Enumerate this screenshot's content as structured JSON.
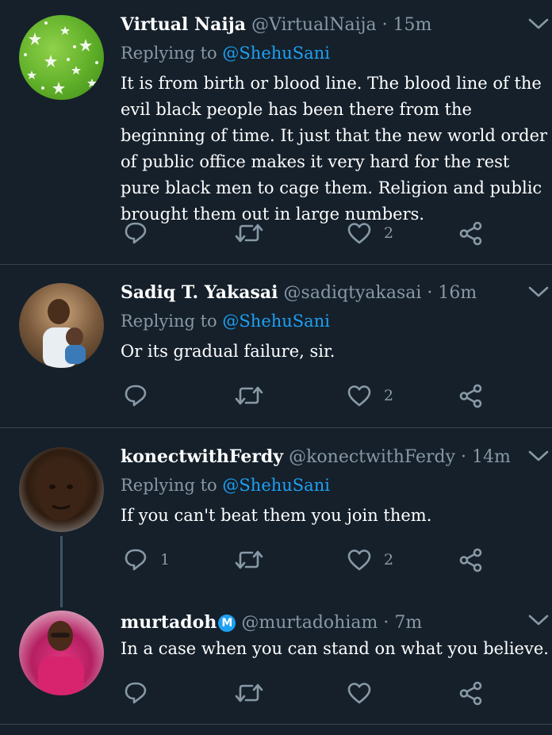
{
  "tweets": [
    {
      "name": "Virtual Naija",
      "handle": "@VirtualNaija",
      "time": "· 15m",
      "replying_prefix": "Replying to",
      "replying_to": "@ShehuSani",
      "text": "It is from birth or blood line. The blood line of the evil black people has been there from the beginning of time. It just that the new world order of public office makes it very hard for the rest pure black men to cage them. Religion and public brought them out in large numbers.",
      "replies": "",
      "retweets": "",
      "likes": "2"
    },
    {
      "name": "Sadiq T. Yakasai",
      "handle": "@sadiqtyakasai",
      "time": "· 16m",
      "replying_prefix": "Replying to",
      "replying_to": "@ShehuSani",
      "text": "Or its gradual failure, sir.",
      "replies": "",
      "retweets": "",
      "likes": "2"
    },
    {
      "name": "konectwithFerdy",
      "handle": "@konectwithFerdy",
      "time": "· 14m",
      "replying_prefix": "Replying to",
      "replying_to": "@ShehuSani",
      "text": "If you can't beat them you join them.",
      "replies": "1",
      "retweets": "",
      "likes": "2"
    },
    {
      "name": "murtadoh",
      "verified_badge": "M",
      "handle": "@murtadohiam",
      "time": "· 7m",
      "text": "In a case when you can stand on what you believe.",
      "replies": "",
      "retweets": "",
      "likes": ""
    }
  ],
  "colors": {
    "background": "#15202b",
    "secondary_text": "#8899a6",
    "accent": "#1da1f2",
    "divider": "#38444d"
  },
  "icons": [
    "reply-icon",
    "retweet-icon",
    "like-icon",
    "share-icon",
    "chevron-down-icon"
  ]
}
